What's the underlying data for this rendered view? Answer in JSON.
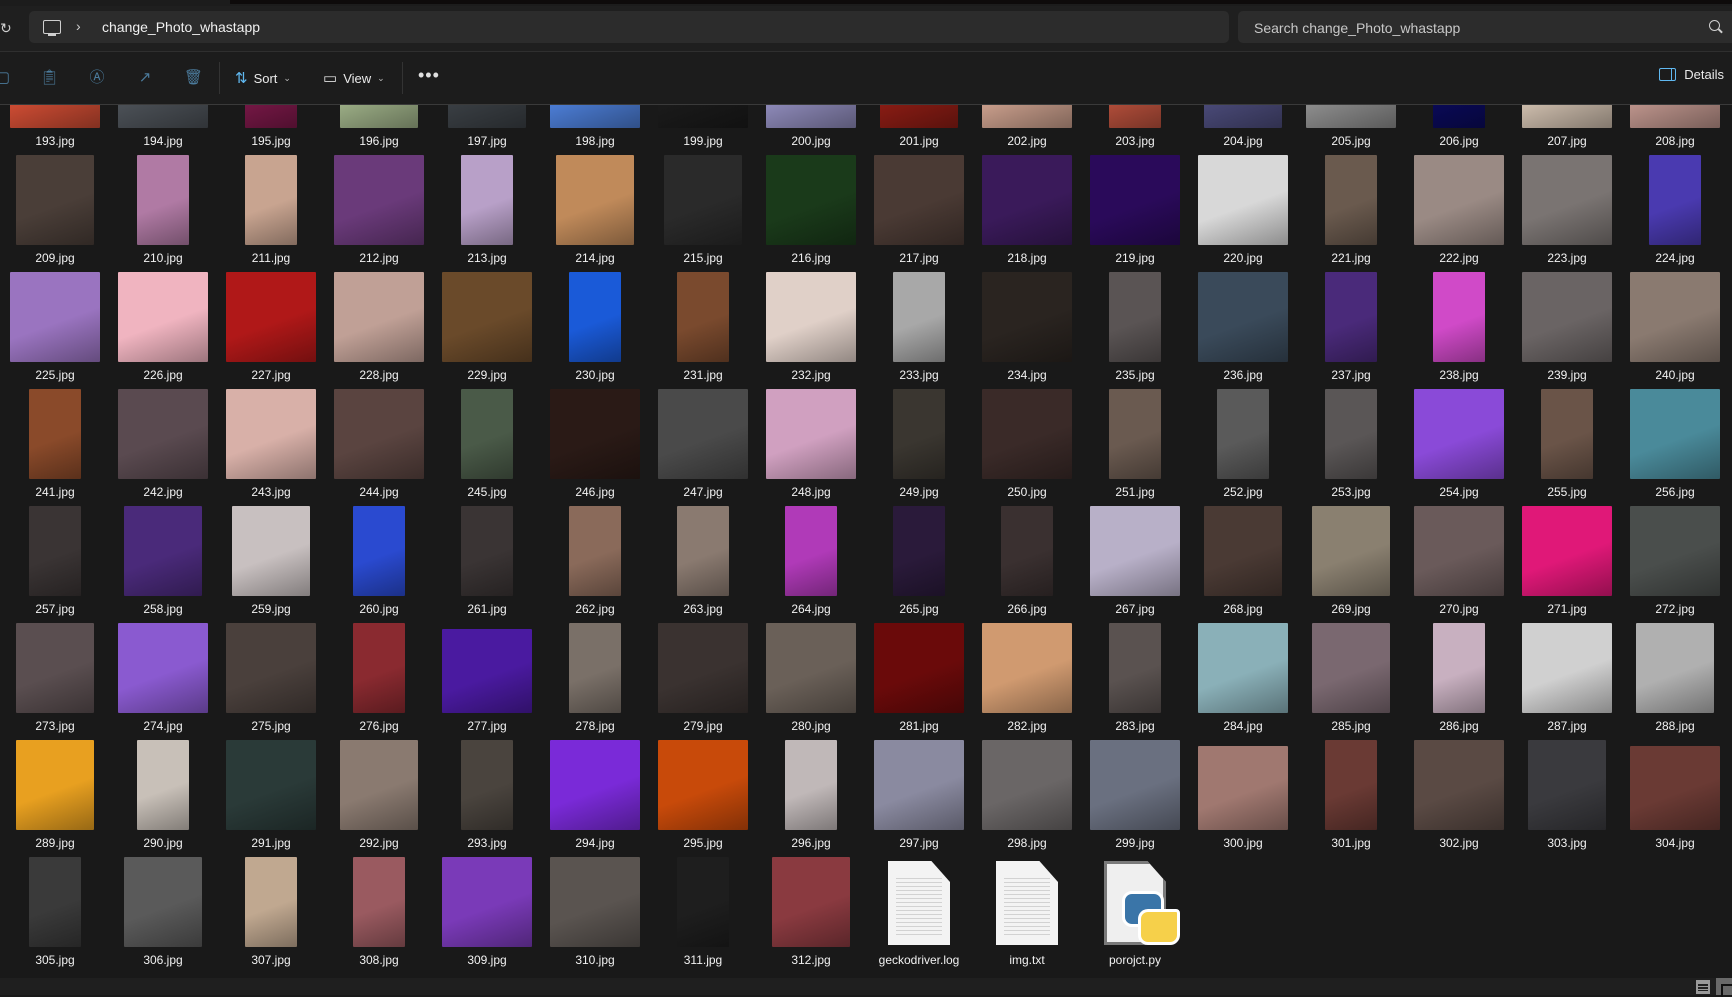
{
  "addressbar": {
    "location_icon": "this-pc-icon",
    "separator": "›",
    "folder": "change_Photo_whastapp"
  },
  "search": {
    "placeholder": "Search change_Photo_whastapp",
    "value": ""
  },
  "toolbar": {
    "icons": [
      "new-icon",
      "paste-icon",
      "rename-icon",
      "share-icon",
      "delete-icon"
    ],
    "sort_label": "Sort",
    "view_label": "View",
    "more_label": "•••",
    "details_label": "Details"
  },
  "files": [
    {
      "name": "193.jpg",
      "color": "#c84a32",
      "shape": "land"
    },
    {
      "name": "194.jpg",
      "color": "#4a4f55",
      "shape": "land"
    },
    {
      "name": "195.jpg",
      "color": "#7a1848",
      "shape": "narrow"
    },
    {
      "name": "196.jpg",
      "color": "#9cae86",
      "shape": "port"
    },
    {
      "name": "197.jpg",
      "color": "#3a3f44",
      "shape": "port"
    },
    {
      "name": "198.jpg",
      "color": "#4a7ad0",
      "shape": "land"
    },
    {
      "name": "199.jpg",
      "color": "#1a1a1a",
      "shape": "land"
    },
    {
      "name": "200.jpg",
      "color": "#8a86b4",
      "shape": "land"
    },
    {
      "name": "201.jpg",
      "color": "#8a1c14",
      "shape": "port"
    },
    {
      "name": "202.jpg",
      "color": "#c49a88",
      "shape": "land"
    },
    {
      "name": "203.jpg",
      "color": "#b8503c",
      "shape": "narrow"
    },
    {
      "name": "204.jpg",
      "color": "#4a4a78",
      "shape": "port"
    },
    {
      "name": "205.jpg",
      "color": "#8a8a8a",
      "shape": "land"
    },
    {
      "name": "206.jpg",
      "color": "#0a0a5a",
      "shape": "narrow"
    },
    {
      "name": "207.jpg",
      "color": "#c8b8a8",
      "shape": "land"
    },
    {
      "name": "208.jpg",
      "color": "#b89088",
      "shape": "land"
    },
    {
      "name": "209.jpg",
      "color": "#4a3e38",
      "shape": "port"
    },
    {
      "name": "210.jpg",
      "color": "#b07aa4",
      "shape": "narrow"
    },
    {
      "name": "211.jpg",
      "color": "#c8a490",
      "shape": "narrow"
    },
    {
      "name": "212.jpg",
      "color": "#6a3a7a",
      "shape": "sq"
    },
    {
      "name": "213.jpg",
      "color": "#b8a0c8",
      "shape": "narrow"
    },
    {
      "name": "214.jpg",
      "color": "#c08a5a",
      "shape": "port"
    },
    {
      "name": "215.jpg",
      "color": "#2a2a2a",
      "shape": "port"
    },
    {
      "name": "216.jpg",
      "color": "#1a3a1a",
      "shape": "sq"
    },
    {
      "name": "217.jpg",
      "color": "#4a3a34",
      "shape": "sq"
    },
    {
      "name": "218.jpg",
      "color": "#3a1a5a",
      "shape": "sq"
    },
    {
      "name": "219.jpg",
      "color": "#2a0a5a",
      "shape": "sq"
    },
    {
      "name": "220.jpg",
      "color": "#d8d8d8",
      "shape": "sq"
    },
    {
      "name": "221.jpg",
      "color": "#6a5a4e",
      "shape": "narrow"
    },
    {
      "name": "222.jpg",
      "color": "#9a8a84",
      "shape": "sq"
    },
    {
      "name": "223.jpg",
      "color": "#7a7472",
      "shape": "sq"
    },
    {
      "name": "224.jpg",
      "color": "#4a3ab0",
      "shape": "narrow"
    },
    {
      "name": "225.jpg",
      "color": "#9a74c0",
      "shape": "sq"
    },
    {
      "name": "226.jpg",
      "color": "#f0b4c0",
      "shape": "sq"
    },
    {
      "name": "227.jpg",
      "color": "#b01818",
      "shape": "sq"
    },
    {
      "name": "228.jpg",
      "color": "#c0a096",
      "shape": "sq"
    },
    {
      "name": "229.jpg",
      "color": "#6a4a2a",
      "shape": "sq"
    },
    {
      "name": "230.jpg",
      "color": "#1a5ad8",
      "shape": "narrow"
    },
    {
      "name": "231.jpg",
      "color": "#7a4a2e",
      "shape": "narrow"
    },
    {
      "name": "232.jpg",
      "color": "#e0d0c8",
      "shape": "sq"
    },
    {
      "name": "233.jpg",
      "color": "#a8a8a8",
      "shape": "narrow"
    },
    {
      "name": "234.jpg",
      "color": "#2a2420",
      "shape": "sq"
    },
    {
      "name": "235.jpg",
      "color": "#5a5454",
      "shape": "narrow"
    },
    {
      "name": "236.jpg",
      "color": "#3a4a5a",
      "shape": "sq"
    },
    {
      "name": "237.jpg",
      "color": "#4a2a7a",
      "shape": "narrow"
    },
    {
      "name": "238.jpg",
      "color": "#d04ac8",
      "shape": "narrow"
    },
    {
      "name": "239.jpg",
      "color": "#6a6464",
      "shape": "sq"
    },
    {
      "name": "240.jpg",
      "color": "#8a7a70",
      "shape": "sq"
    },
    {
      "name": "241.jpg",
      "color": "#8a4a2a",
      "shape": "narrow"
    },
    {
      "name": "242.jpg",
      "color": "#5a4a50",
      "shape": "sq"
    },
    {
      "name": "243.jpg",
      "color": "#d8b0a8",
      "shape": "sq"
    },
    {
      "name": "244.jpg",
      "color": "#5a4440",
      "shape": "sq"
    },
    {
      "name": "245.jpg",
      "color": "#4a5a48",
      "shape": "narrow"
    },
    {
      "name": "246.jpg",
      "color": "#2a1a16",
      "shape": "sq"
    },
    {
      "name": "247.jpg",
      "color": "#4a4a4a",
      "shape": "sq"
    },
    {
      "name": "248.jpg",
      "color": "#d0a0c0",
      "shape": "sq"
    },
    {
      "name": "249.jpg",
      "color": "#3a3630",
      "shape": "narrow"
    },
    {
      "name": "250.jpg",
      "color": "#3a2a28",
      "shape": "sq"
    },
    {
      "name": "251.jpg",
      "color": "#6a5a50",
      "shape": "narrow"
    },
    {
      "name": "252.jpg",
      "color": "#5a5a5a",
      "shape": "narrow"
    },
    {
      "name": "253.jpg",
      "color": "#5a5656",
      "shape": "narrow"
    },
    {
      "name": "254.jpg",
      "color": "#8a4ad8",
      "shape": "sq"
    },
    {
      "name": "255.jpg",
      "color": "#6a5448",
      "shape": "narrow"
    },
    {
      "name": "256.jpg",
      "color": "#4a8a9a",
      "shape": "sq"
    },
    {
      "name": "257.jpg",
      "color": "#3a3434",
      "shape": "narrow"
    },
    {
      "name": "258.jpg",
      "color": "#4a2a7a",
      "shape": "port"
    },
    {
      "name": "259.jpg",
      "color": "#c8c0c0",
      "shape": "port"
    },
    {
      "name": "260.jpg",
      "color": "#2a4ad0",
      "shape": "narrow"
    },
    {
      "name": "261.jpg",
      "color": "#3a3434",
      "shape": "narrow"
    },
    {
      "name": "262.jpg",
      "color": "#8a6a5a",
      "shape": "narrow"
    },
    {
      "name": "263.jpg",
      "color": "#8a7a70",
      "shape": "narrow"
    },
    {
      "name": "264.jpg",
      "color": "#b03ab8",
      "shape": "narrow"
    },
    {
      "name": "265.jpg",
      "color": "#2a1a3a",
      "shape": "narrow"
    },
    {
      "name": "266.jpg",
      "color": "#3a3030",
      "shape": "narrow"
    },
    {
      "name": "267.jpg",
      "color": "#b8b0c8",
      "shape": "sq"
    },
    {
      "name": "268.jpg",
      "color": "#4a3a34",
      "shape": "port"
    },
    {
      "name": "269.jpg",
      "color": "#8a8070",
      "shape": "port"
    },
    {
      "name": "270.jpg",
      "color": "#6a5a5a",
      "shape": "sq"
    },
    {
      "name": "271.jpg",
      "color": "#e01878",
      "shape": "sq"
    },
    {
      "name": "272.jpg",
      "color": "#4a4e4c",
      "shape": "sq"
    },
    {
      "name": "273.jpg",
      "color": "#5a4e50",
      "shape": "port"
    },
    {
      "name": "274.jpg",
      "color": "#8a5ad0",
      "shape": "sq"
    },
    {
      "name": "275.jpg",
      "color": "#4a403c",
      "shape": "sq"
    },
    {
      "name": "276.jpg",
      "color": "#8a2a30",
      "shape": "narrow"
    },
    {
      "name": "277.jpg",
      "color": "#4a1aa0",
      "shape": "land"
    },
    {
      "name": "278.jpg",
      "color": "#7a7068",
      "shape": "narrow"
    },
    {
      "name": "279.jpg",
      "color": "#3a3230",
      "shape": "sq"
    },
    {
      "name": "280.jpg",
      "color": "#6a6058",
      "shape": "sq"
    },
    {
      "name": "281.jpg",
      "color": "#6a0a0a",
      "shape": "sq"
    },
    {
      "name": "282.jpg",
      "color": "#d09a70",
      "shape": "sq"
    },
    {
      "name": "283.jpg",
      "color": "#5a5250",
      "shape": "narrow"
    },
    {
      "name": "284.jpg",
      "color": "#8ab0b8",
      "shape": "sq"
    },
    {
      "name": "285.jpg",
      "color": "#7a6870",
      "shape": "port"
    },
    {
      "name": "286.jpg",
      "color": "#c8b0c0",
      "shape": "narrow"
    },
    {
      "name": "287.jpg",
      "color": "#d0d0d0",
      "shape": "sq"
    },
    {
      "name": "288.jpg",
      "color": "#b0b0b0",
      "shape": "port"
    },
    {
      "name": "289.jpg",
      "color": "#e8a020",
      "shape": "port"
    },
    {
      "name": "290.jpg",
      "color": "#c8c0b8",
      "shape": "narrow"
    },
    {
      "name": "291.jpg",
      "color": "#2a3a38",
      "shape": "sq"
    },
    {
      "name": "292.jpg",
      "color": "#8a7a70",
      "shape": "port"
    },
    {
      "name": "293.jpg",
      "color": "#4a443e",
      "shape": "narrow"
    },
    {
      "name": "294.jpg",
      "color": "#7a2ad8",
      "shape": "sq"
    },
    {
      "name": "295.jpg",
      "color": "#c84a0a",
      "shape": "sq"
    },
    {
      "name": "296.jpg",
      "color": "#c0b8b8",
      "shape": "narrow"
    },
    {
      "name": "297.jpg",
      "color": "#8a8aa0",
      "shape": "sq"
    },
    {
      "name": "298.jpg",
      "color": "#6a6666",
      "shape": "sq"
    },
    {
      "name": "299.jpg",
      "color": "#6a7080",
      "shape": "sq"
    },
    {
      "name": "300.jpg",
      "color": "#a07870",
      "shape": "land"
    },
    {
      "name": "301.jpg",
      "color": "#6a3a34",
      "shape": "narrow"
    },
    {
      "name": "302.jpg",
      "color": "#5a4a44",
      "shape": "sq"
    },
    {
      "name": "303.jpg",
      "color": "#3a3a3e",
      "shape": "port"
    },
    {
      "name": "304.jpg",
      "color": "#6a3a34",
      "shape": "land"
    },
    {
      "name": "305.jpg",
      "color": "#3a3a3a",
      "shape": "narrow"
    },
    {
      "name": "306.jpg",
      "color": "#5a5a5a",
      "shape": "port"
    },
    {
      "name": "307.jpg",
      "color": "#c0a890",
      "shape": "narrow"
    },
    {
      "name": "308.jpg",
      "color": "#9a5a60",
      "shape": "narrow"
    },
    {
      "name": "309.jpg",
      "color": "#7a3ab8",
      "shape": "sq"
    },
    {
      "name": "310.jpg",
      "color": "#5a5450",
      "shape": "sq"
    },
    {
      "name": "311.jpg",
      "color": "#1e1e1e",
      "shape": "narrow"
    },
    {
      "name": "312.jpg",
      "color": "#8a3a40",
      "shape": "port"
    },
    {
      "name": "geckodriver.log",
      "type": "log"
    },
    {
      "name": "img.txt",
      "type": "txt"
    },
    {
      "name": "porojct.py",
      "type": "py"
    }
  ]
}
